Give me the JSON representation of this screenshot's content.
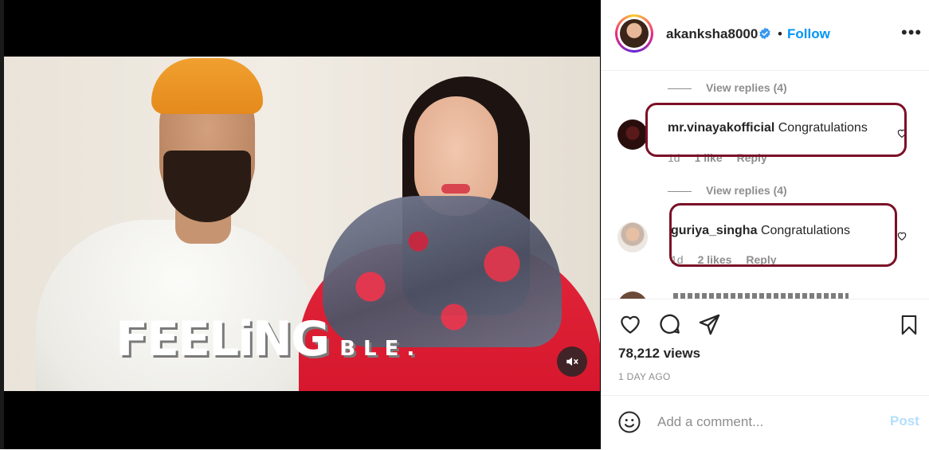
{
  "video": {
    "overlay_text": "FEELiNG",
    "overlay_text_small": "BLE.",
    "mute_icon": "speaker-muted-icon"
  },
  "header": {
    "username": "akanksha8000",
    "verified_icon": "verified-badge-icon",
    "separator": "•",
    "follow_label": "Follow",
    "more_label": "•••"
  },
  "comments": {
    "threads": [
      {
        "view_replies": "View replies (4)",
        "username": "mr.vinayakofficial",
        "text": "Congratulations",
        "time": "1d",
        "likes": "1 like",
        "reply": "Reply"
      },
      {
        "view_replies": "View replies (4)",
        "username": "guriya_singha",
        "text": "Congratulations",
        "time": "1d",
        "likes": "2 likes",
        "reply": "Reply"
      }
    ],
    "highlight_color": "#7b1026"
  },
  "actions": {
    "views": "78,212 views",
    "age": "1 DAY AGO"
  },
  "add_comment": {
    "placeholder": "Add a comment...",
    "post_label": "Post"
  },
  "colors": {
    "accent": "#0095f6",
    "post_disabled": "#b2dffc",
    "muted_text": "#8e8e8e"
  }
}
